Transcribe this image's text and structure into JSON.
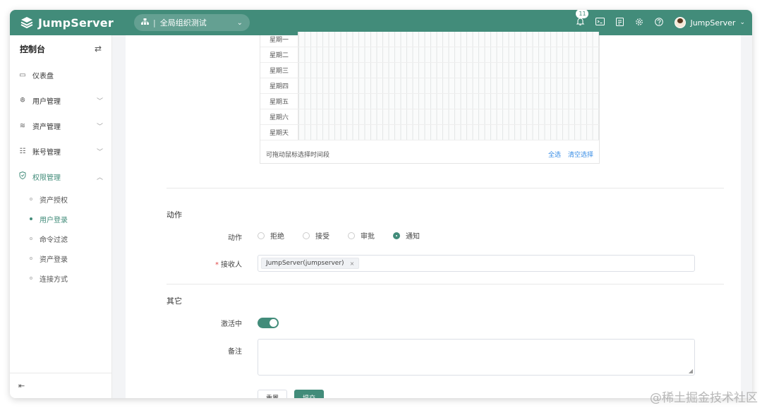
{
  "app": {
    "logo_text": "JumpServer",
    "org_selector": "全局组织测试",
    "notification_count": "11",
    "user_name": "JumpServer",
    "brand_color": "#428c7a"
  },
  "sidebar": {
    "title": "控制台",
    "items": [
      {
        "label": "仪表盘",
        "icon": "dashboard-icon"
      },
      {
        "label": "用户管理",
        "icon": "users-icon"
      },
      {
        "label": "资产管理",
        "icon": "assets-icon"
      },
      {
        "label": "账号管理",
        "icon": "accounts-icon"
      },
      {
        "label": "权限管理",
        "icon": "shield-icon"
      }
    ],
    "subitems": [
      {
        "label": "资产授权"
      },
      {
        "label": "用户登录"
      },
      {
        "label": "命令过滤"
      },
      {
        "label": "资产登录"
      },
      {
        "label": "连接方式"
      }
    ]
  },
  "schedule": {
    "days": [
      "星期一",
      "星期二",
      "星期三",
      "星期四",
      "星期五",
      "星期六",
      "星期天"
    ],
    "hint": "可拖动鼠标选择时间段",
    "select_all": "全选",
    "clear_selection": "清空选择"
  },
  "action_section": {
    "title": "动作",
    "action_label": "动作",
    "options": [
      "拒绝",
      "接受",
      "审批",
      "通知"
    ],
    "selected": "通知",
    "receiver_label": "接收人",
    "receiver_tag": "JumpServer(jumpserver)",
    "receiver_tag_close": "×"
  },
  "other_section": {
    "title": "其它",
    "active_label": "激活中",
    "active": true,
    "comment_label": "备注"
  },
  "buttons": {
    "reset": "重置",
    "submit": "提交"
  },
  "watermark": "@稀土掘金技术社区"
}
